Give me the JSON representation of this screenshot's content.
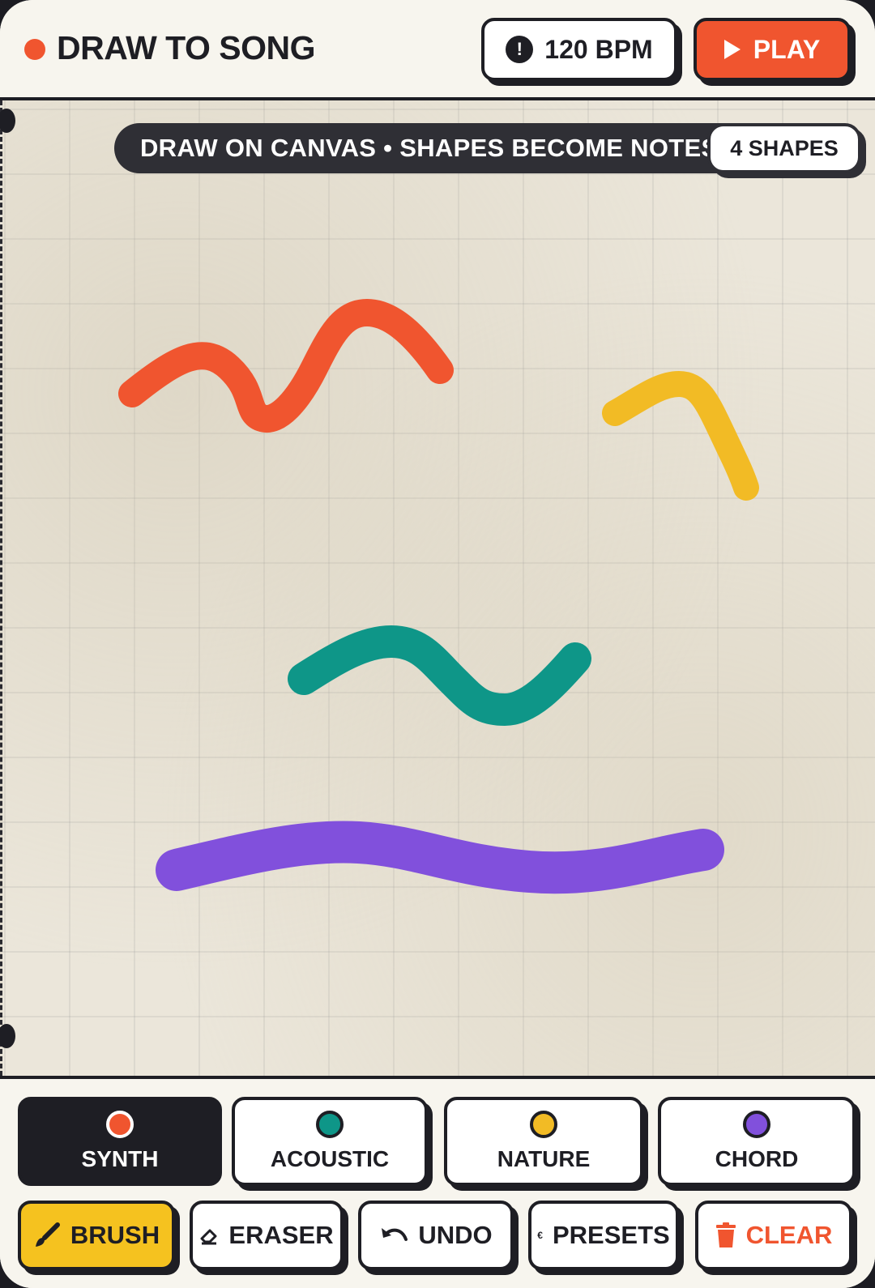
{
  "header": {
    "title": "DRAW TO SONG",
    "bpm_label": "120 BPM",
    "play_label": "PLAY"
  },
  "canvas": {
    "hint": "DRAW ON CANVAS • SHAPES BECOME NOTES",
    "shape_count": "4 SHAPES",
    "strokes": [
      {
        "instrument": "synth",
        "color": "#f0552f"
      },
      {
        "instrument": "nature",
        "color": "#f2bb25"
      },
      {
        "instrument": "acoustic",
        "color": "#0e9688"
      },
      {
        "instrument": "chord",
        "color": "#8150dc"
      }
    ]
  },
  "instruments": [
    {
      "label": "SYNTH",
      "color": "#f0552f",
      "active": true
    },
    {
      "label": "ACOUSTIC",
      "color": "#0e9688",
      "active": false
    },
    {
      "label": "NATURE",
      "color": "#f2bb25",
      "active": false
    },
    {
      "label": "CHORD",
      "color": "#8150dc",
      "active": false
    }
  ],
  "tools": [
    {
      "label": "BRUSH",
      "icon": "brush-icon",
      "active": true
    },
    {
      "label": "ERASER",
      "icon": "eraser-icon",
      "active": false
    },
    {
      "label": "UNDO",
      "icon": "undo-icon",
      "active": false
    },
    {
      "label": "PRESETS",
      "icon": "presets-icon",
      "active": false
    },
    {
      "label": "CLEAR",
      "icon": "trash-icon",
      "active": false
    }
  ],
  "colors": {
    "accent": "#f0552f",
    "ink": "#1e1e24",
    "paper": "#ebe6da",
    "brush_active": "#f5c21f"
  }
}
